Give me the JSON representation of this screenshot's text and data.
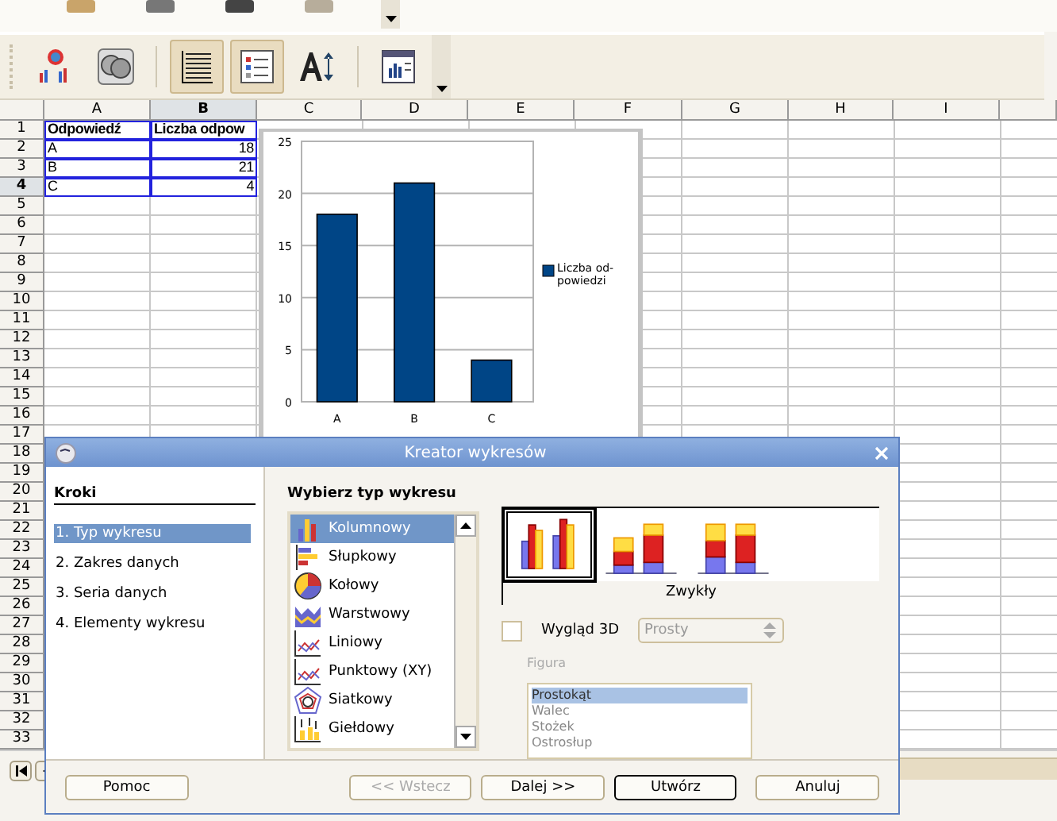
{
  "toolbar": {
    "buttons": [
      {
        "kind": "chart-type",
        "pressed": false
      },
      {
        "kind": "sphere",
        "pressed": false
      },
      {
        "kind": "grid",
        "pressed": true
      },
      {
        "kind": "legend",
        "pressed": true
      },
      {
        "kind": "text-scale",
        "pressed": false
      },
      {
        "kind": "data-table",
        "pressed": false
      }
    ]
  },
  "sheet": {
    "columns": [
      {
        "label": "A",
        "selected": false
      },
      {
        "label": "B",
        "selected": true
      },
      {
        "label": "C",
        "selected": false
      },
      {
        "label": "D",
        "selected": false
      },
      {
        "label": "E",
        "selected": false
      },
      {
        "label": "F",
        "selected": false
      },
      {
        "label": "G",
        "selected": false
      },
      {
        "label": "H",
        "selected": false
      },
      {
        "label": "I",
        "selected": false
      }
    ],
    "rows": [
      {
        "label": "1",
        "selected": false,
        "cells": [
          "Odpowiedź",
          "Liczba odpow"
        ]
      },
      {
        "label": "2",
        "selected": false,
        "cells": [
          "A",
          "18"
        ]
      },
      {
        "label": "3",
        "selected": false,
        "cells": [
          "B",
          "21"
        ]
      },
      {
        "label": "4",
        "selected": true,
        "cells": [
          "C",
          "4"
        ]
      },
      {
        "label": "5",
        "selected": false
      },
      {
        "label": "6",
        "selected": false
      },
      {
        "label": "7",
        "selected": false
      },
      {
        "label": "8",
        "selected": false
      },
      {
        "label": "9",
        "selected": false
      },
      {
        "label": "10",
        "selected": false
      },
      {
        "label": "11",
        "selected": false
      },
      {
        "label": "12",
        "selected": false
      },
      {
        "label": "13",
        "selected": false
      },
      {
        "label": "14",
        "selected": false
      },
      {
        "label": "15",
        "selected": false
      },
      {
        "label": "16",
        "selected": false
      },
      {
        "label": "17",
        "selected": false
      },
      {
        "label": "18",
        "selected": false
      },
      {
        "label": "19",
        "selected": false
      },
      {
        "label": "20",
        "selected": false
      },
      {
        "label": "21",
        "selected": false
      },
      {
        "label": "22",
        "selected": false
      },
      {
        "label": "23",
        "selected": false
      },
      {
        "label": "24",
        "selected": false
      },
      {
        "label": "25",
        "selected": false
      },
      {
        "label": "26",
        "selected": false
      },
      {
        "label": "27",
        "selected": false
      },
      {
        "label": "28",
        "selected": false
      },
      {
        "label": "29",
        "selected": false
      },
      {
        "label": "30",
        "selected": false
      },
      {
        "label": "31",
        "selected": false
      },
      {
        "label": "32",
        "selected": false
      },
      {
        "label": "33",
        "selected": false
      }
    ],
    "chart": {
      "chart_data": {
        "type": "bar",
        "categories": [
          "A",
          "B",
          "C"
        ],
        "series": [
          {
            "name": "Liczba od- powiedzi",
            "color": "#004586",
            "values": [
              18,
              21,
              4
            ]
          }
        ],
        "ylim": [
          0,
          25
        ],
        "yticks": [
          0,
          5,
          10,
          15,
          20,
          25
        ],
        "grid": true
      }
    }
  },
  "dialog": {
    "title": "Kreator wykresów",
    "steps": {
      "heading": "Kroki",
      "items": [
        {
          "label": "1. Typ wykresu",
          "selected": true
        },
        {
          "label": "2. Zakres danych",
          "selected": false
        },
        {
          "label": "3. Seria danych",
          "selected": false
        },
        {
          "label": "4. Elementy wykresu",
          "selected": false
        }
      ]
    },
    "chart_types": {
      "heading": "Wybierz typ wykresu",
      "items": [
        {
          "kind": "column",
          "label": "Kolumnowy",
          "selected": true
        },
        {
          "kind": "bar",
          "label": "Słupkowy",
          "selected": false
        },
        {
          "kind": "pie",
          "label": "Kołowy",
          "selected": false
        },
        {
          "kind": "area",
          "label": "Warstwowy",
          "selected": false
        },
        {
          "kind": "line",
          "label": "Liniowy",
          "selected": false
        },
        {
          "kind": "xy",
          "label": "Punktowy (XY)",
          "selected": false
        },
        {
          "kind": "net",
          "label": "Siatkowy",
          "selected": false
        },
        {
          "kind": "stock",
          "label": "Giełdowy",
          "selected": false
        }
      ]
    },
    "variants": {
      "caption": "Zwykły",
      "items": [
        {
          "kind": "normal",
          "selected": true
        },
        {
          "kind": "stacked",
          "selected": false
        },
        {
          "kind": "percent",
          "selected": false
        }
      ]
    },
    "three_d": {
      "label": "Wygląd 3D",
      "checked": false
    },
    "shape_select": {
      "value": "Prosty",
      "disabled": true
    },
    "figure": {
      "label": "Figura",
      "disabled": true,
      "items": [
        {
          "label": "Prostokąt",
          "selected": true
        },
        {
          "label": "Walec",
          "selected": false
        },
        {
          "label": "Stożek",
          "selected": false
        },
        {
          "label": "Ostrosłup",
          "selected": false
        }
      ]
    },
    "buttons": [
      {
        "label": "Pomoc",
        "disabled": false,
        "default": false
      },
      {
        "label": "<< Wstecz",
        "disabled": true,
        "default": false
      },
      {
        "label": "Dalej >>",
        "disabled": false,
        "default": false
      },
      {
        "label": "Utwórz",
        "disabled": false,
        "default": true
      },
      {
        "label": "Anuluj",
        "disabled": false,
        "default": false
      }
    ]
  }
}
